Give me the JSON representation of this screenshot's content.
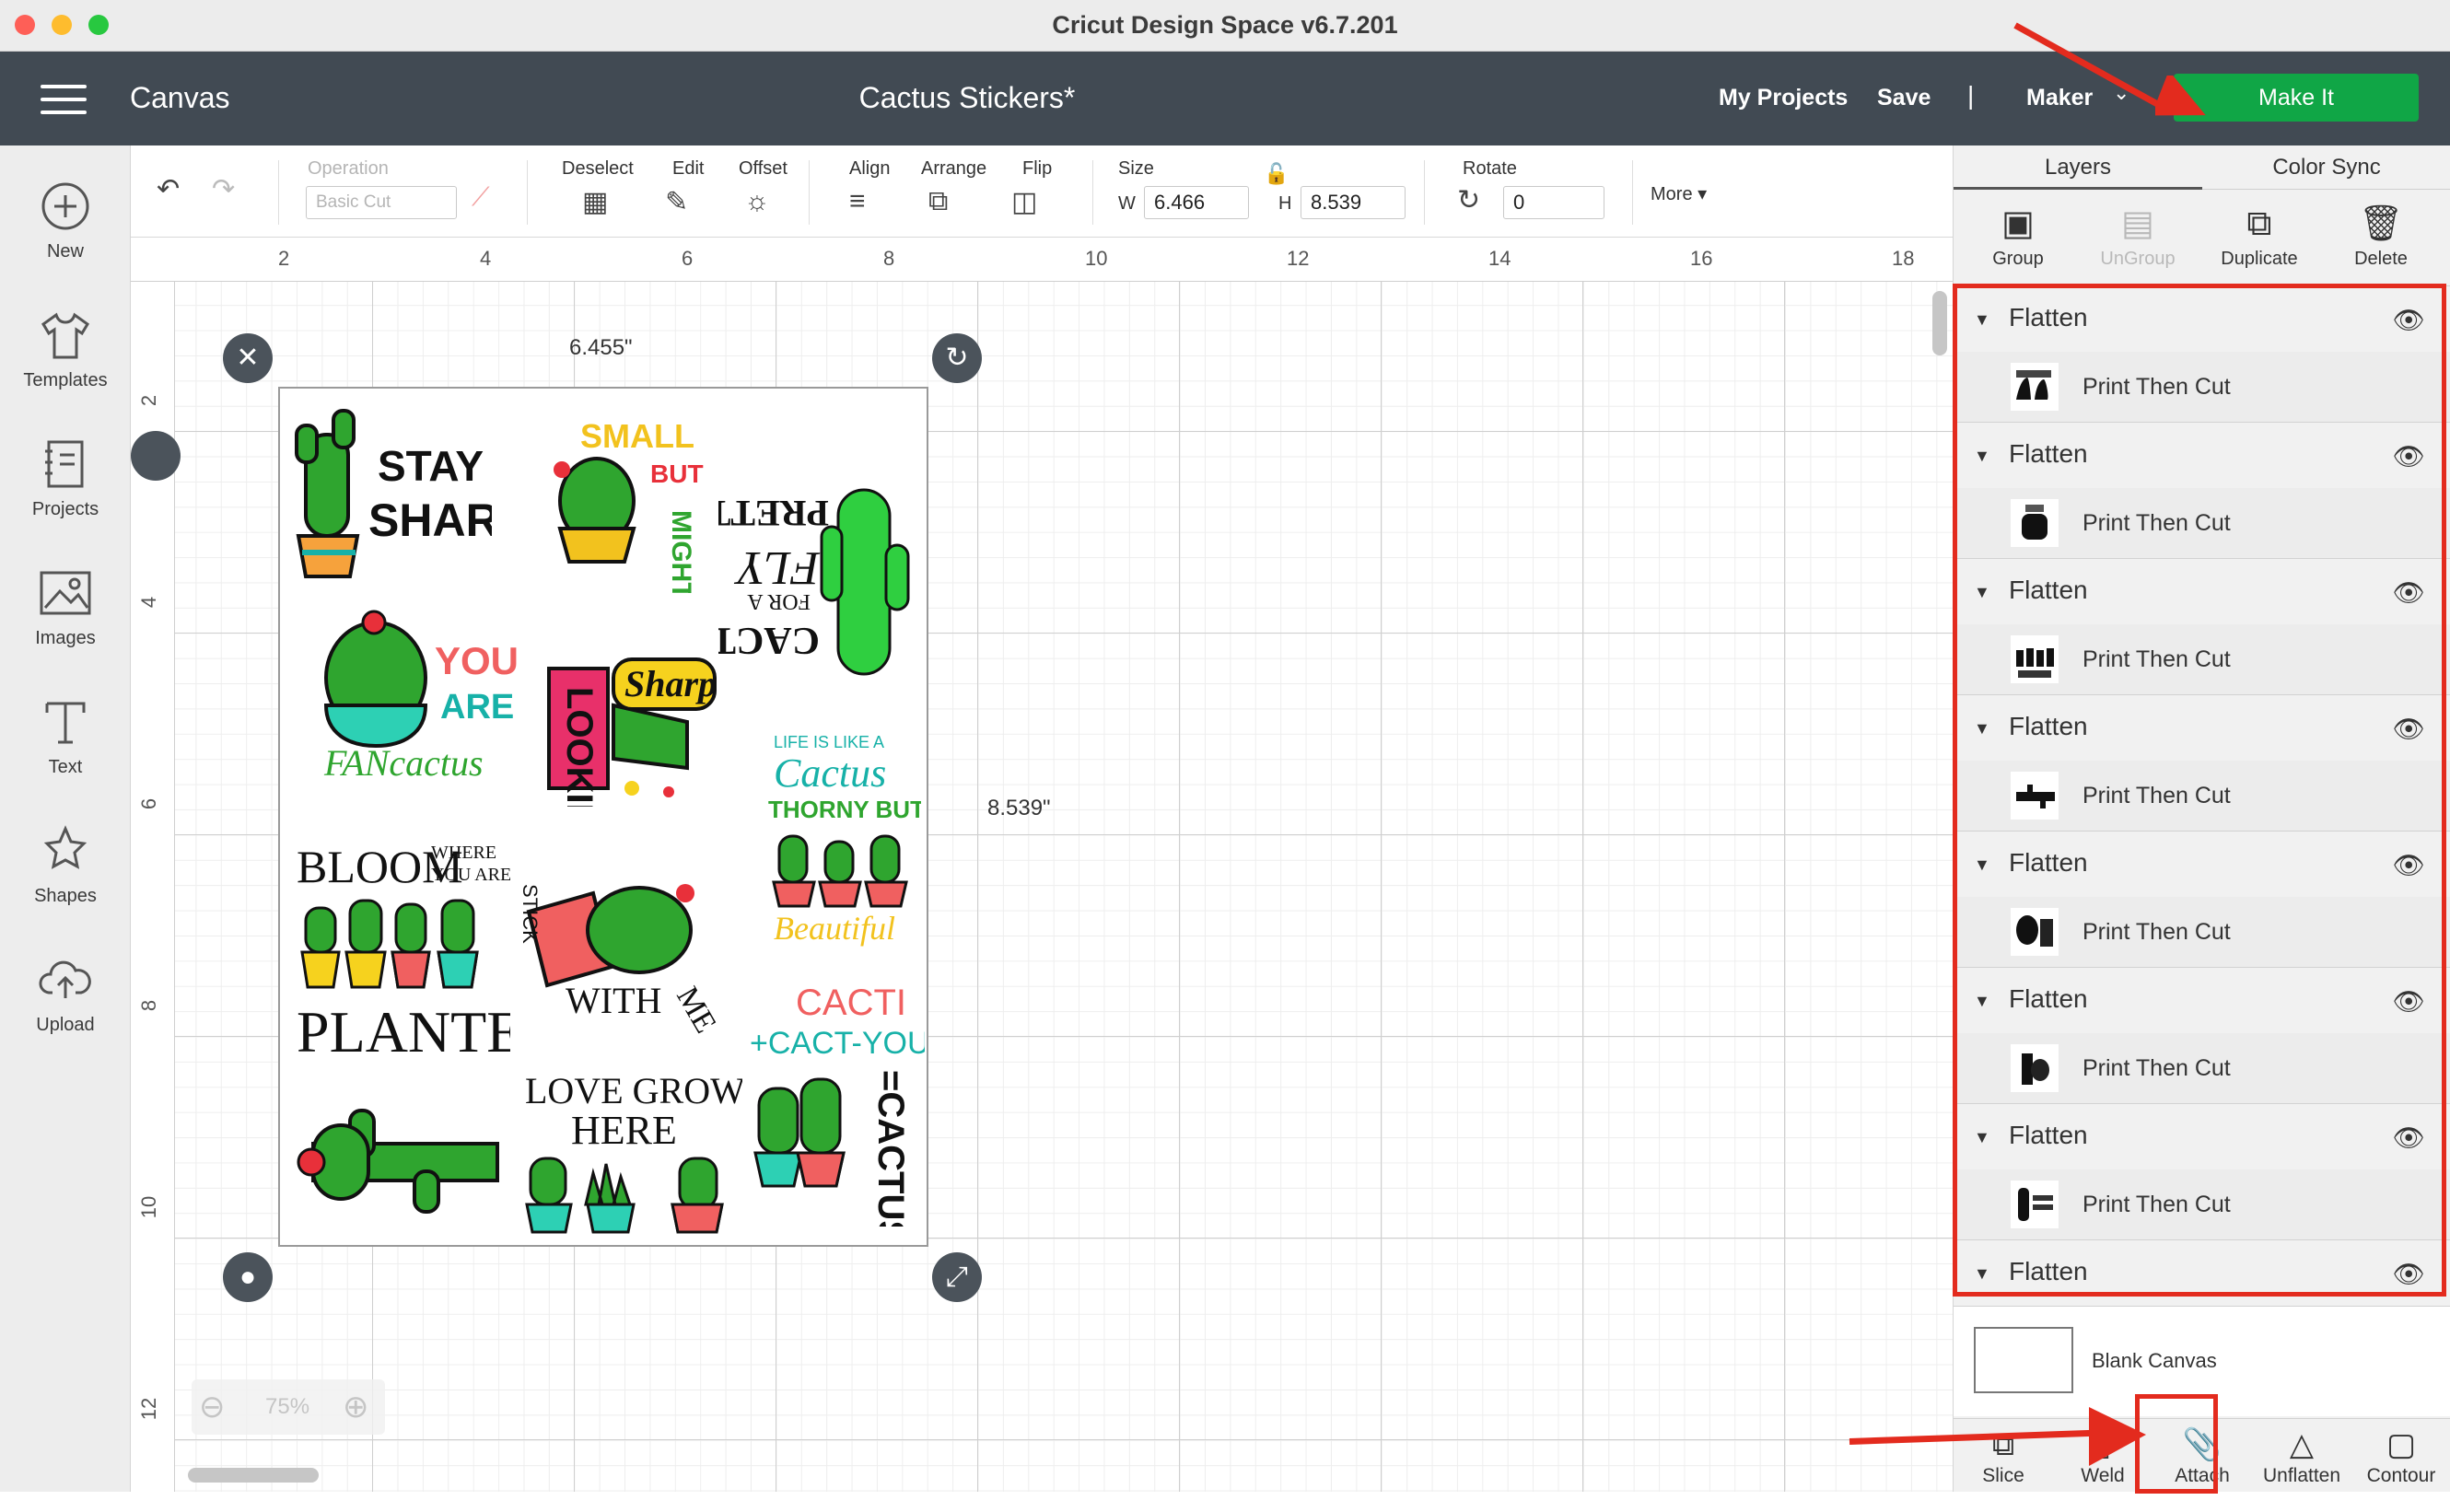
{
  "app": {
    "window_title": "Cricut Design Space  v6.7.201"
  },
  "header": {
    "section": "Canvas",
    "doc_title": "Cactus Stickers*",
    "my_projects": "My Projects",
    "save": "Save",
    "separator": "|",
    "machine": "Maker",
    "make_it": "Make It"
  },
  "sidebar": {
    "items": [
      {
        "label": "New",
        "icon": "plus-circle-icon"
      },
      {
        "label": "Templates",
        "icon": "shirt-icon"
      },
      {
        "label": "Projects",
        "icon": "projects-icon"
      },
      {
        "label": "Images",
        "icon": "image-icon"
      },
      {
        "label": "Text",
        "icon": "text-icon"
      },
      {
        "label": "Shapes",
        "icon": "shapes-icon"
      },
      {
        "label": "Upload",
        "icon": "upload-cloud-icon"
      }
    ]
  },
  "toolbar": {
    "operation_label": "Operation",
    "operation_value": "Basic Cut",
    "deselect": "Deselect",
    "edit": "Edit",
    "offset": "Offset",
    "align": "Align",
    "arrange": "Arrange",
    "flip": "Flip",
    "size": "Size",
    "w_label": "W",
    "w_value": "6.466",
    "h_label": "H",
    "h_value": "8.539",
    "rotate": "Rotate",
    "rotate_value": "0",
    "more": "More"
  },
  "canvas": {
    "ruler_top": [
      "2",
      "4",
      "6",
      "8",
      "10",
      "12",
      "14",
      "16",
      "18"
    ],
    "ruler_left": [
      "2",
      "4",
      "6",
      "8",
      "10",
      "12"
    ],
    "dim_width": "6.455\"",
    "dim_height": "8.539\"",
    "zoom": "75%",
    "stickers": [
      {
        "lines": [
          "STAY",
          "SHARP"
        ]
      },
      {
        "lines": [
          "SMALL",
          "BUT",
          "MIGHTY"
        ]
      },
      {
        "lines": [
          "PRETTY",
          "FLY",
          "FOR A",
          "CACTI"
        ]
      },
      {
        "lines": [
          "YOU",
          "ARE",
          "FANcactus"
        ]
      },
      {
        "lines": [
          "LOOKIN",
          "Sharp"
        ]
      },
      {
        "lines": [
          "LIFE IS LIKE A",
          "Cactus",
          "THORNY BUT",
          "Beautiful"
        ]
      },
      {
        "lines": [
          "BLOOM",
          "WHERE",
          "YOU ARE",
          "PLANTED"
        ]
      },
      {
        "lines": [
          "STICK",
          "WITH",
          "ME"
        ]
      },
      {
        "lines": [
          "CACTI",
          "+CACT-YOU",
          "=CACTUS"
        ]
      },
      {
        "lines": []
      },
      {
        "lines": [
          "LOVE GROWS",
          "HERE"
        ]
      }
    ]
  },
  "panel": {
    "tabs": [
      "Layers",
      "Color Sync"
    ],
    "tools": [
      "Group",
      "UnGroup",
      "Duplicate",
      "Delete"
    ],
    "layers": [
      {
        "group": "Flatten",
        "child": "Print Then Cut"
      },
      {
        "group": "Flatten",
        "child": "Print Then Cut"
      },
      {
        "group": "Flatten",
        "child": "Print Then Cut"
      },
      {
        "group": "Flatten",
        "child": "Print Then Cut"
      },
      {
        "group": "Flatten",
        "child": "Print Then Cut"
      },
      {
        "group": "Flatten",
        "child": "Print Then Cut"
      },
      {
        "group": "Flatten",
        "child": "Print Then Cut"
      },
      {
        "group": "Flatten",
        "child": ""
      }
    ],
    "blank_canvas": "Blank Canvas",
    "bottom_tools": [
      "Slice",
      "Weld",
      "Attach",
      "Unflatten",
      "Contour"
    ]
  },
  "colors": {
    "header_bg": "#414a53",
    "make_it": "#10a646",
    "annotation": "#e32b1e"
  }
}
